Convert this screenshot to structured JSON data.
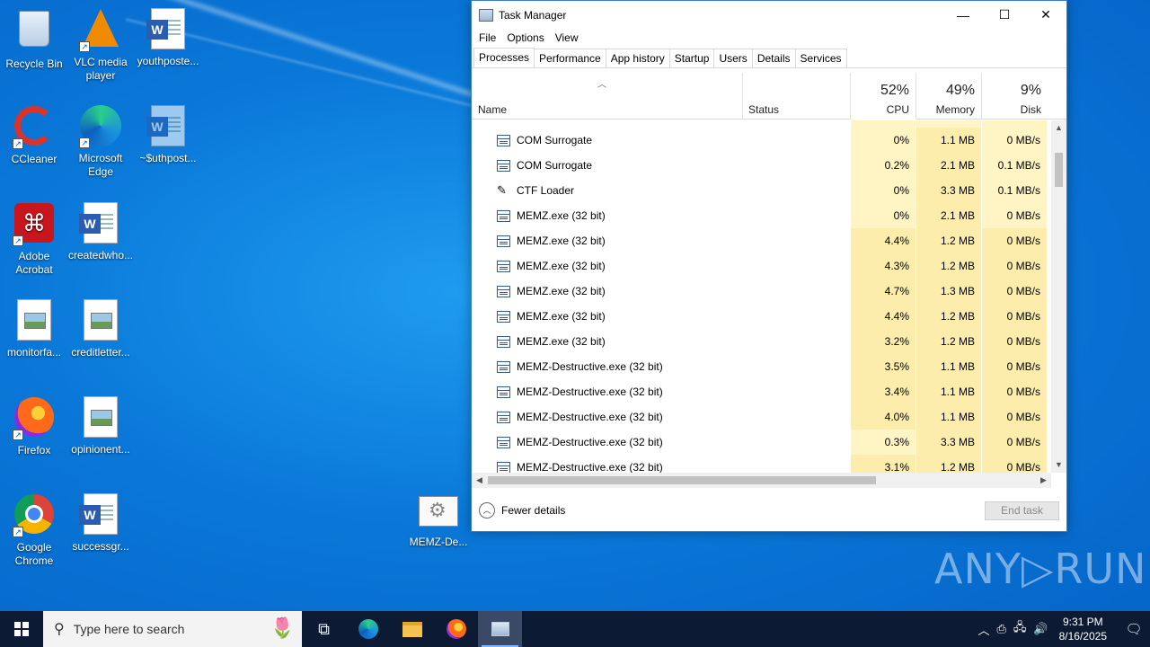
{
  "desktop": {
    "icons": [
      {
        "label": "Recycle Bin"
      },
      {
        "label": "VLC media player"
      },
      {
        "label": "youthposte..."
      },
      {
        "label": "CCleaner"
      },
      {
        "label": "Microsoft Edge"
      },
      {
        "label": "~$uthpost..."
      },
      {
        "label": "Adobe Acrobat"
      },
      {
        "label": "createdwho..."
      },
      {
        "label": "monitorfa..."
      },
      {
        "label": "creditletter..."
      },
      {
        "label": "Firefox"
      },
      {
        "label": "opinionent..."
      },
      {
        "label": "Google Chrome"
      },
      {
        "label": "successgr..."
      },
      {
        "label": "MEMZ-De..."
      }
    ],
    "watermark": "ANY▷RUN"
  },
  "taskmanager": {
    "title": "Task Manager",
    "controls": {
      "minimize": "—",
      "maximize": "☐",
      "close": "✕"
    },
    "menu": [
      "File",
      "Options",
      "View"
    ],
    "tabs": [
      "Processes",
      "Performance",
      "App history",
      "Startup",
      "Users",
      "Details",
      "Services"
    ],
    "active_tab": "Processes",
    "columns": {
      "name": "Name",
      "status": "Status",
      "cpu": {
        "value": "52%",
        "label": "CPU"
      },
      "memory": {
        "value": "49%",
        "label": "Memory"
      },
      "disk": {
        "value": "9%",
        "label": "Disk"
      }
    },
    "rows": [
      {
        "name": "COM Surrogate",
        "icon": "window-icon",
        "cpu": "0%",
        "memory": "1.1 MB",
        "disk": "0 MB/s"
      },
      {
        "name": "COM Surrogate",
        "icon": "window-icon",
        "cpu": "0.2%",
        "memory": "2.1 MB",
        "disk": "0.1 MB/s"
      },
      {
        "name": "CTF Loader",
        "icon": "pen-icon",
        "cpu": "0%",
        "memory": "3.3 MB",
        "disk": "0.1 MB/s"
      },
      {
        "name": "MEMZ.exe (32 bit)",
        "icon": "window-icon",
        "cpu": "0%",
        "memory": "2.1 MB",
        "disk": "0 MB/s"
      },
      {
        "name": "MEMZ.exe (32 bit)",
        "icon": "window-icon",
        "cpu": "4.4%",
        "memory": "1.2 MB",
        "disk": "0 MB/s"
      },
      {
        "name": "MEMZ.exe (32 bit)",
        "icon": "window-icon",
        "cpu": "4.3%",
        "memory": "1.2 MB",
        "disk": "0 MB/s"
      },
      {
        "name": "MEMZ.exe (32 bit)",
        "icon": "window-icon",
        "cpu": "4.7%",
        "memory": "1.3 MB",
        "disk": "0 MB/s"
      },
      {
        "name": "MEMZ.exe (32 bit)",
        "icon": "window-icon",
        "cpu": "4.4%",
        "memory": "1.2 MB",
        "disk": "0 MB/s"
      },
      {
        "name": "MEMZ.exe (32 bit)",
        "icon": "window-icon",
        "cpu": "3.2%",
        "memory": "1.2 MB",
        "disk": "0 MB/s"
      },
      {
        "name": "MEMZ-Destructive.exe (32 bit)",
        "icon": "window-icon",
        "cpu": "3.5%",
        "memory": "1.1 MB",
        "disk": "0 MB/s"
      },
      {
        "name": "MEMZ-Destructive.exe (32 bit)",
        "icon": "window-icon",
        "cpu": "3.4%",
        "memory": "1.1 MB",
        "disk": "0 MB/s"
      },
      {
        "name": "MEMZ-Destructive.exe (32 bit)",
        "icon": "window-icon",
        "cpu": "4.0%",
        "memory": "1.1 MB",
        "disk": "0 MB/s"
      },
      {
        "name": "MEMZ-Destructive.exe (32 bit)",
        "icon": "window-icon",
        "cpu": "0.3%",
        "memory": "3.3 MB",
        "disk": "0 MB/s"
      },
      {
        "name": "MEMZ-Destructive.exe (32 bit)",
        "icon": "window-icon",
        "cpu": "3.1%",
        "memory": "1.2 MB",
        "disk": "0 MB/s"
      }
    ],
    "footer": {
      "fewer_details": "Fewer details",
      "end_task": "End task"
    }
  },
  "taskbar": {
    "search_placeholder": "Type here to search",
    "time": "9:31 PM",
    "date": "8/16/2025"
  },
  "colors": {
    "cell_light": "#fff4c4",
    "cell_mid": "#fcedac",
    "desktop_blue": "#0a78d8",
    "taskbar": "#0c1a33"
  }
}
